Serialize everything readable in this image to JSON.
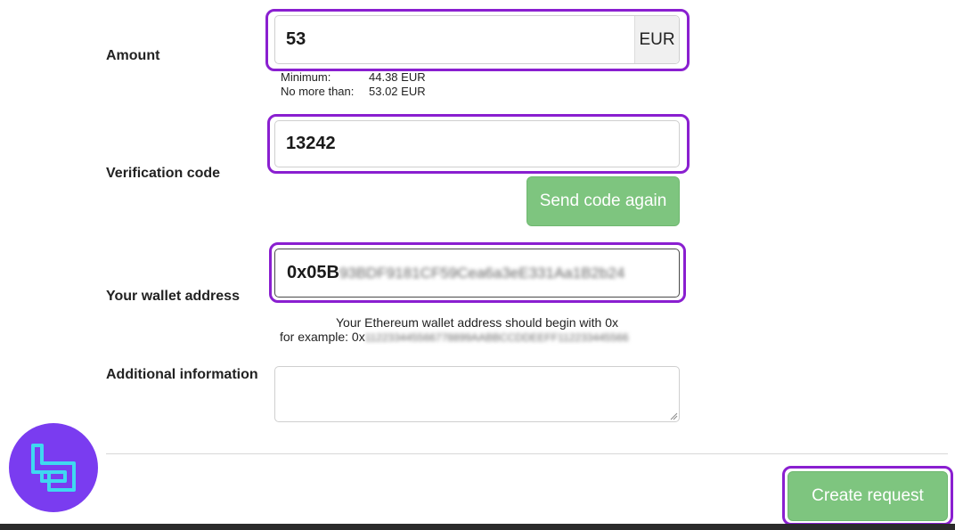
{
  "amount": {
    "label": "Amount",
    "value": "53",
    "currency": "EUR",
    "min_label": "Minimum:",
    "min_value": "44.38 EUR",
    "max_label": "No more than:",
    "max_value": "53.02 EUR"
  },
  "verification": {
    "label": "Verification code",
    "value": "13242",
    "resend_label": "Send code again"
  },
  "wallet": {
    "label": "Your wallet address",
    "value_prefix": "0x05B",
    "value_rest": "93BDF9181CF59Cea6a3eE331Aa1B2b24",
    "hint_line1": "Your Ethereum wallet address should begin with 0x",
    "hint_example_label": "for example: 0x",
    "hint_example_value": "112233445566778899AABBCCDDEEFF112233445566"
  },
  "additional": {
    "label": "Additional information",
    "value": ""
  },
  "create_request_label": "Create request",
  "colors": {
    "highlight": "#8a1fd0",
    "button_green": "#7ec57f",
    "logo_purple": "#7a3cf0",
    "logo_cyan": "#3fd8f0"
  }
}
